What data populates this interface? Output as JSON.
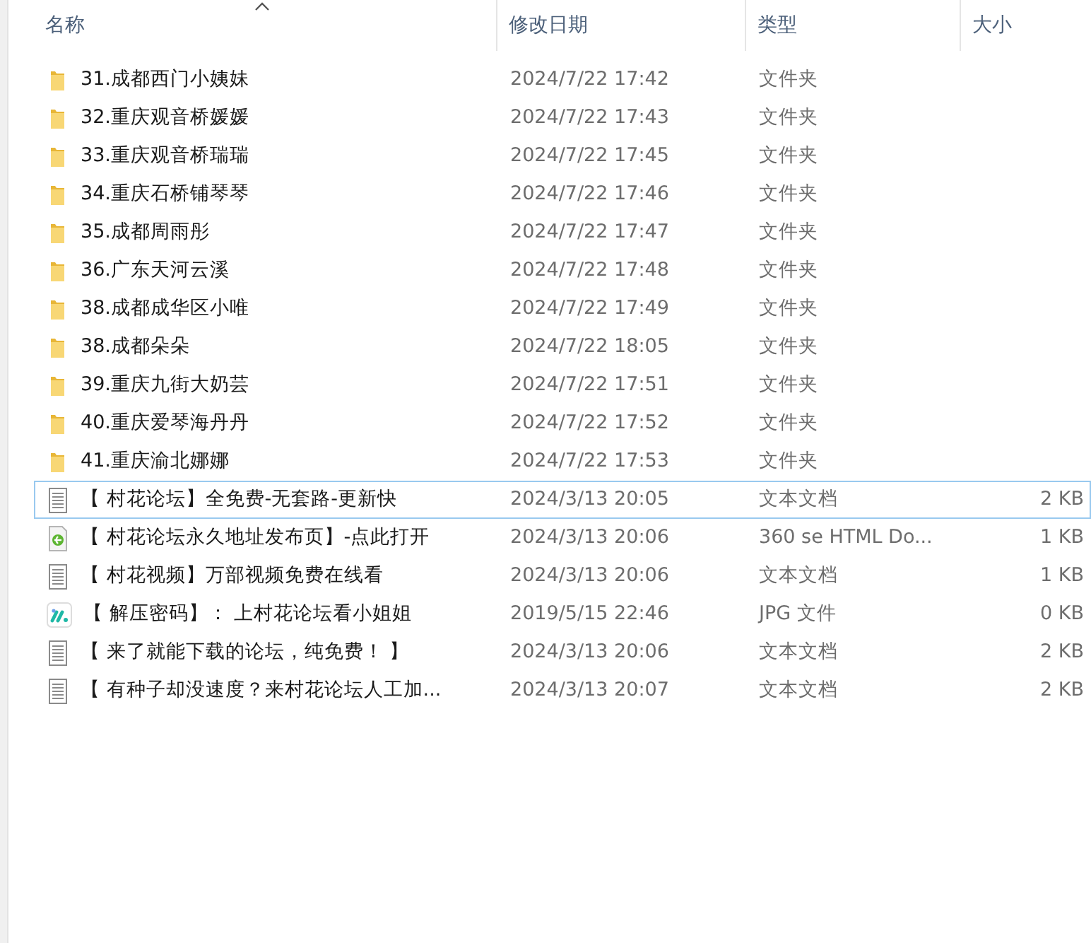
{
  "columns": [
    {
      "label": "名称",
      "sorted": true
    },
    {
      "label": "修改日期",
      "sorted": false
    },
    {
      "label": "类型",
      "sorted": false
    },
    {
      "label": "大小",
      "sorted": false
    }
  ],
  "files": [
    {
      "kind": "folder",
      "name": "31.成都西门小姨妹",
      "modified": "2024/7/22 17:42",
      "type": "文件夹",
      "focused": false
    },
    {
      "kind": "folder",
      "name": "32.重庆观音桥媛媛",
      "modified": "2024/7/22 17:43",
      "type": "文件夹",
      "focused": false
    },
    {
      "kind": "folder",
      "name": "33.重庆观音桥瑞瑞",
      "modified": "2024/7/22 17:45",
      "type": "文件夹",
      "focused": false
    },
    {
      "kind": "folder",
      "name": "34.重庆石桥铺琴琴",
      "modified": "2024/7/22 17:46",
      "type": "文件夹",
      "focused": false
    },
    {
      "kind": "folder",
      "name": "35.成都周雨彤",
      "modified": "2024/7/22 17:47",
      "type": "文件夹",
      "focused": false
    },
    {
      "kind": "folder",
      "name": "36.广东天河云溪",
      "modified": "2024/7/22 17:48",
      "type": "文件夹",
      "focused": false
    },
    {
      "kind": "folder",
      "name": "38.成都成华区小唯",
      "modified": "2024/7/22 17:49",
      "type": "文件夹",
      "focused": false
    },
    {
      "kind": "folder",
      "name": "38.成都朵朵",
      "modified": "2024/7/22 18:05",
      "type": "文件夹",
      "focused": false
    },
    {
      "kind": "folder",
      "name": "39.重庆九街大奶芸",
      "modified": "2024/7/22 17:51",
      "type": "文件夹",
      "focused": false
    },
    {
      "kind": "folder",
      "name": "40.重庆爱琴海丹丹",
      "modified": "2024/7/22 17:52",
      "type": "文件夹",
      "focused": false
    },
    {
      "kind": "folder",
      "name": "41.重庆渝北娜娜",
      "modified": "2024/7/22 17:53",
      "type": "文件夹",
      "focused": false
    },
    {
      "kind": "text",
      "name": "【 村花论坛】全免费-无套路-更新快",
      "modified": "2024/3/13 20:05",
      "type": "文本文档",
      "size": "2 KB",
      "focused": true
    },
    {
      "kind": "html",
      "name": "【 村花论坛永久地址发布页】-点此打开",
      "modified": "2024/3/13 20:06",
      "type": "360 se HTML Do...",
      "size": "1 KB",
      "focused": false
    },
    {
      "kind": "text",
      "name": "【 村花视频】万部视频免费在线看",
      "modified": "2024/3/13 20:06",
      "type": "文本文档",
      "size": "1 KB",
      "focused": false
    },
    {
      "kind": "image",
      "name": "【 解压密码】： 上村花论坛看小姐姐",
      "modified": "2019/5/15 22:46",
      "type": "JPG 文件",
      "size": "0 KB",
      "focused": false
    },
    {
      "kind": "text",
      "name": "【 来了就能下载的论坛，纯免费！ 】",
      "modified": "2024/3/13 20:06",
      "type": "文本文档",
      "size": "2 KB",
      "focused": false
    },
    {
      "kind": "text",
      "name": "【 有种子却没速度？来村花论坛人工加...",
      "modified": "2024/3/13 20:07",
      "type": "文本文档",
      "size": "2 KB",
      "focused": false
    }
  ]
}
